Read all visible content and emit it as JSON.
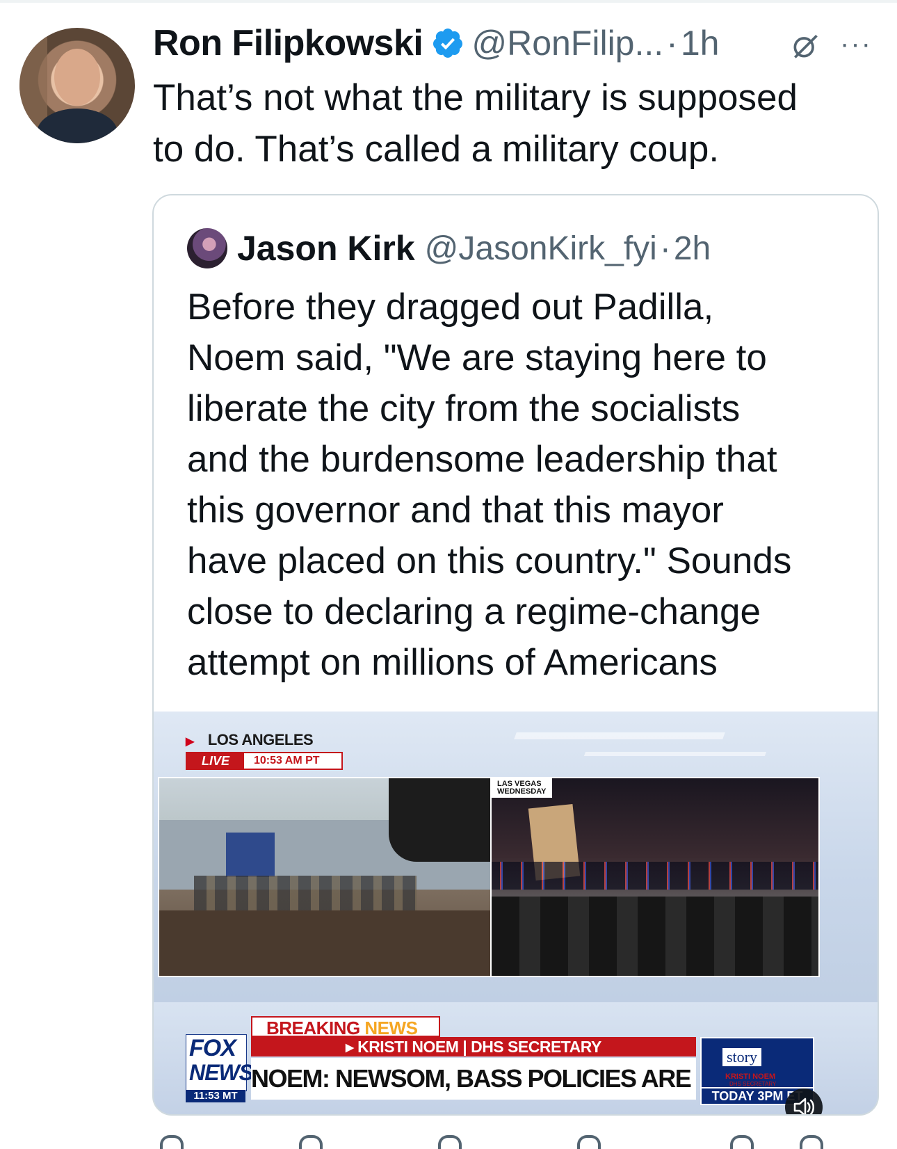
{
  "post": {
    "author_name": "Ron Filipkowski",
    "author_handle": "@RonFilip...",
    "separator": "·",
    "time": "1h",
    "more_label": "···",
    "text": "That’s not what the military is supposed\nto do. That’s called a military coup."
  },
  "quoted_post": {
    "author_name": "Jason Kirk",
    "author_handle": "@JasonKirk_fyi",
    "separator": "·",
    "time": "2h",
    "text": "Before they dragged out Padilla,\nNoem said, \"We are staying here to\nliberate the city from the socialists\nand the burdensome leadership that\nthis governor and that this mayor\nhave placed on this country.\" Sounds\nclose to declaring a regime-change\nattempt on millions of Americans",
    "video": {
      "location": "LOS ANGELES",
      "live_label": "LIVE",
      "live_time": "10:53 AM PT",
      "right_panel_tag_line1": "LAS VEGAS",
      "right_panel_tag_line2": "WEDNESDAY",
      "breaking_word1": "BREAKING",
      "breaking_word2": "NEWS",
      "speaker_line": "▸ KRISTI NOEM | DHS SECRETARY",
      "headline": "NOEM: NEWSOM, BASS POLICIES ARE A HUGE DISSERVICE",
      "network_logo_line1": "FOX",
      "network_logo_line2": "NEWS",
      "network_time": "11:53 MT",
      "promo_title": "story",
      "promo_name": "KRISTI NOEM",
      "promo_title2": "DHS SECRETARY",
      "promo_time": "TODAY 3PM ET"
    }
  },
  "colors": {
    "verified_blue": "#1d9bf0",
    "secondary_text": "#536471",
    "border": "#cfd9de",
    "fox_red": "#c4161c",
    "fox_blue": "#0a2a78"
  },
  "icons": [
    "verified-badge-icon",
    "grok-icon",
    "more-icon",
    "mute-icon",
    "reply-icon",
    "repost-icon",
    "like-icon",
    "views-icon",
    "bookmark-icon",
    "share-icon"
  ]
}
